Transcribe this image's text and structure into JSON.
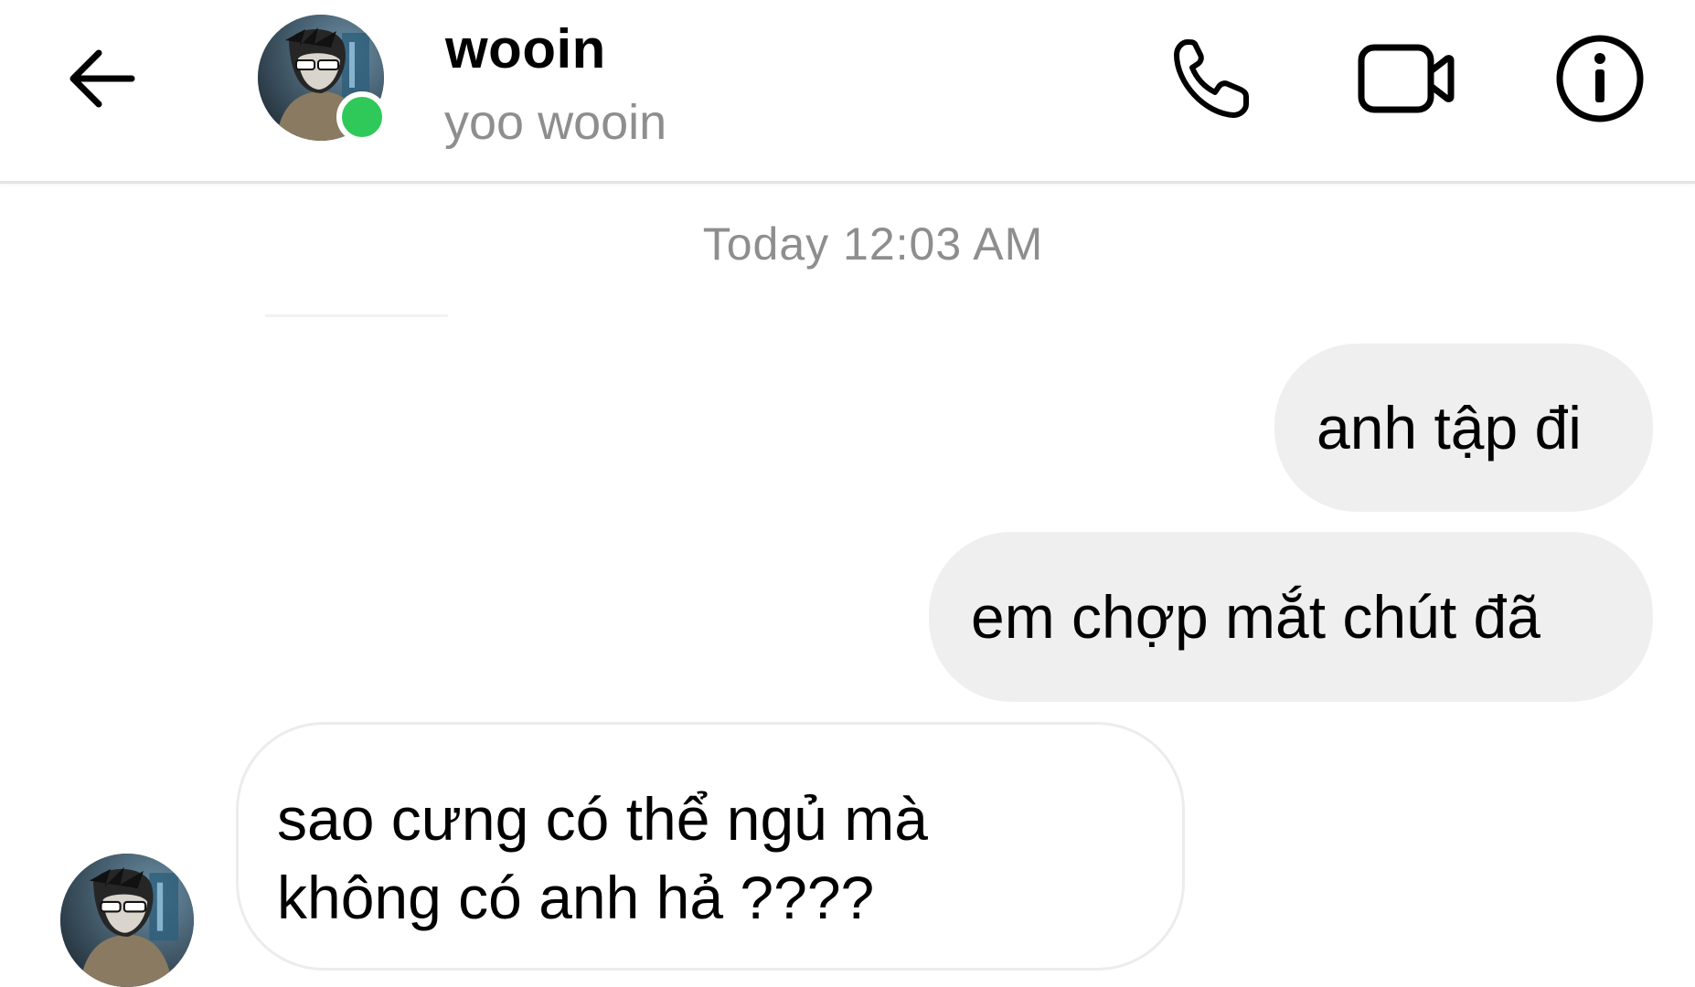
{
  "header": {
    "back_icon": "arrow-left-icon",
    "contact_name": "wooin",
    "contact_subtitle": "yoo wooin",
    "online_status_color": "#2fc95a",
    "actions": [
      {
        "icon": "phone-icon"
      },
      {
        "icon": "video-camera-icon"
      },
      {
        "icon": "info-icon"
      }
    ]
  },
  "conversation": {
    "timestamp": "Today 12:03 AM",
    "messages": [
      {
        "direction": "sent",
        "text": "anh tập đi"
      },
      {
        "direction": "sent",
        "text": "em chợp mắt chút đã"
      },
      {
        "direction": "received",
        "lines": [
          "sao cưng có thể ngủ mà",
          "không có anh hả ????"
        ]
      }
    ]
  },
  "colors": {
    "sent_bubble": "#efefef",
    "received_border": "#ececec",
    "muted_text": "#8e8e8e"
  }
}
